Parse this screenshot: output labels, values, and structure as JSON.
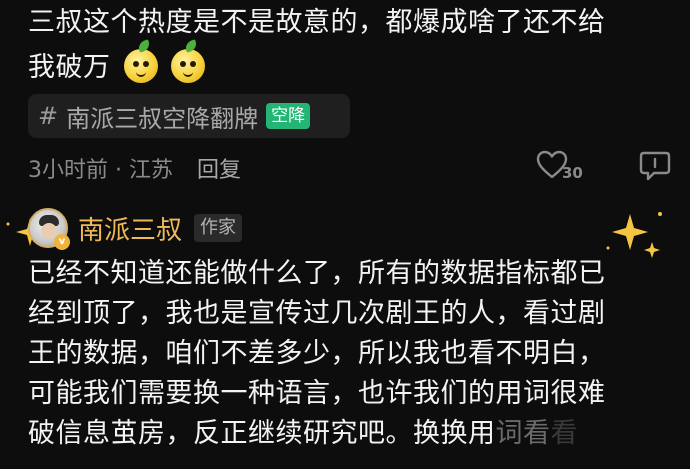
{
  "comment": {
    "text_line1": "三叔这个热度是不是故意的，都爆成啥了还不给",
    "text_line2": "我破万",
    "emojis": [
      "lemon-face-icon",
      "lemon-face-icon"
    ]
  },
  "topic": {
    "hash": "#",
    "text": "南派三叔空降翻牌",
    "tag": "空降",
    "tag_color": "#22b573"
  },
  "meta": {
    "time_location": "3小时前 · 江苏",
    "reply_label": "回复",
    "like_count": "30"
  },
  "author_reply": {
    "name": "南派三叔",
    "name_color": "#f0b957",
    "badge": "作家",
    "vip_mark": "v",
    "lines": [
      "已经不知道还能做什么了，所有的数据指标都已",
      "经到顶了，我也是宣传过几次剧王的人，看过剧",
      "王的数据，咱们不差多少，所以我也看不明白，",
      "可能我们需要换一种语言，也许我们的用词很难",
      "破信息茧房，反正继续研究吧。换换用"
    ],
    "line5_fade": "词看",
    "line5_fade2": "看"
  }
}
